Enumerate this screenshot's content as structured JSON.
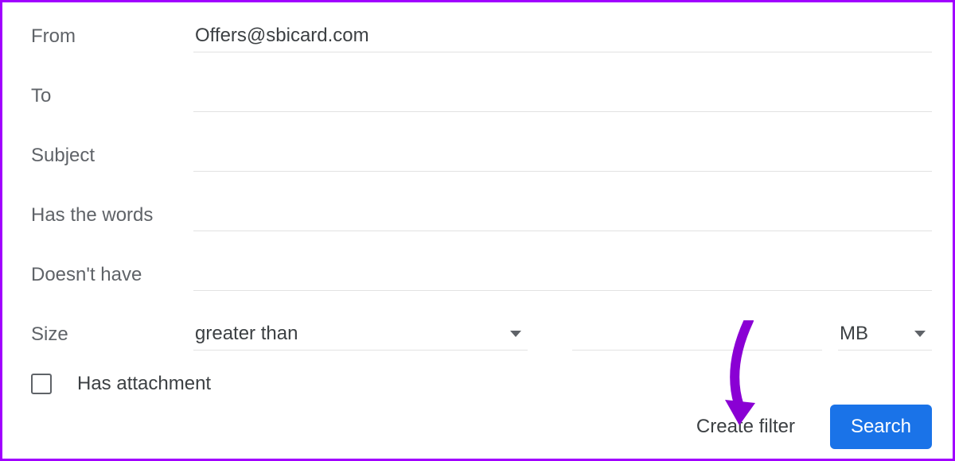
{
  "fields": {
    "from_label": "From",
    "from_value": "Offers@sbicard.com",
    "to_label": "To",
    "to_value": "",
    "subject_label": "Subject",
    "subject_value": "",
    "haswords_label": "Has the words",
    "haswords_value": "",
    "doesnthave_label": "Doesn't have",
    "doesnthave_value": "",
    "size_label": "Size",
    "size_op": "greater than",
    "size_value": "",
    "size_unit": "MB",
    "attachment_label": "Has attachment",
    "attachment_checked": false
  },
  "footer": {
    "create_filter": "Create filter",
    "search": "Search"
  }
}
